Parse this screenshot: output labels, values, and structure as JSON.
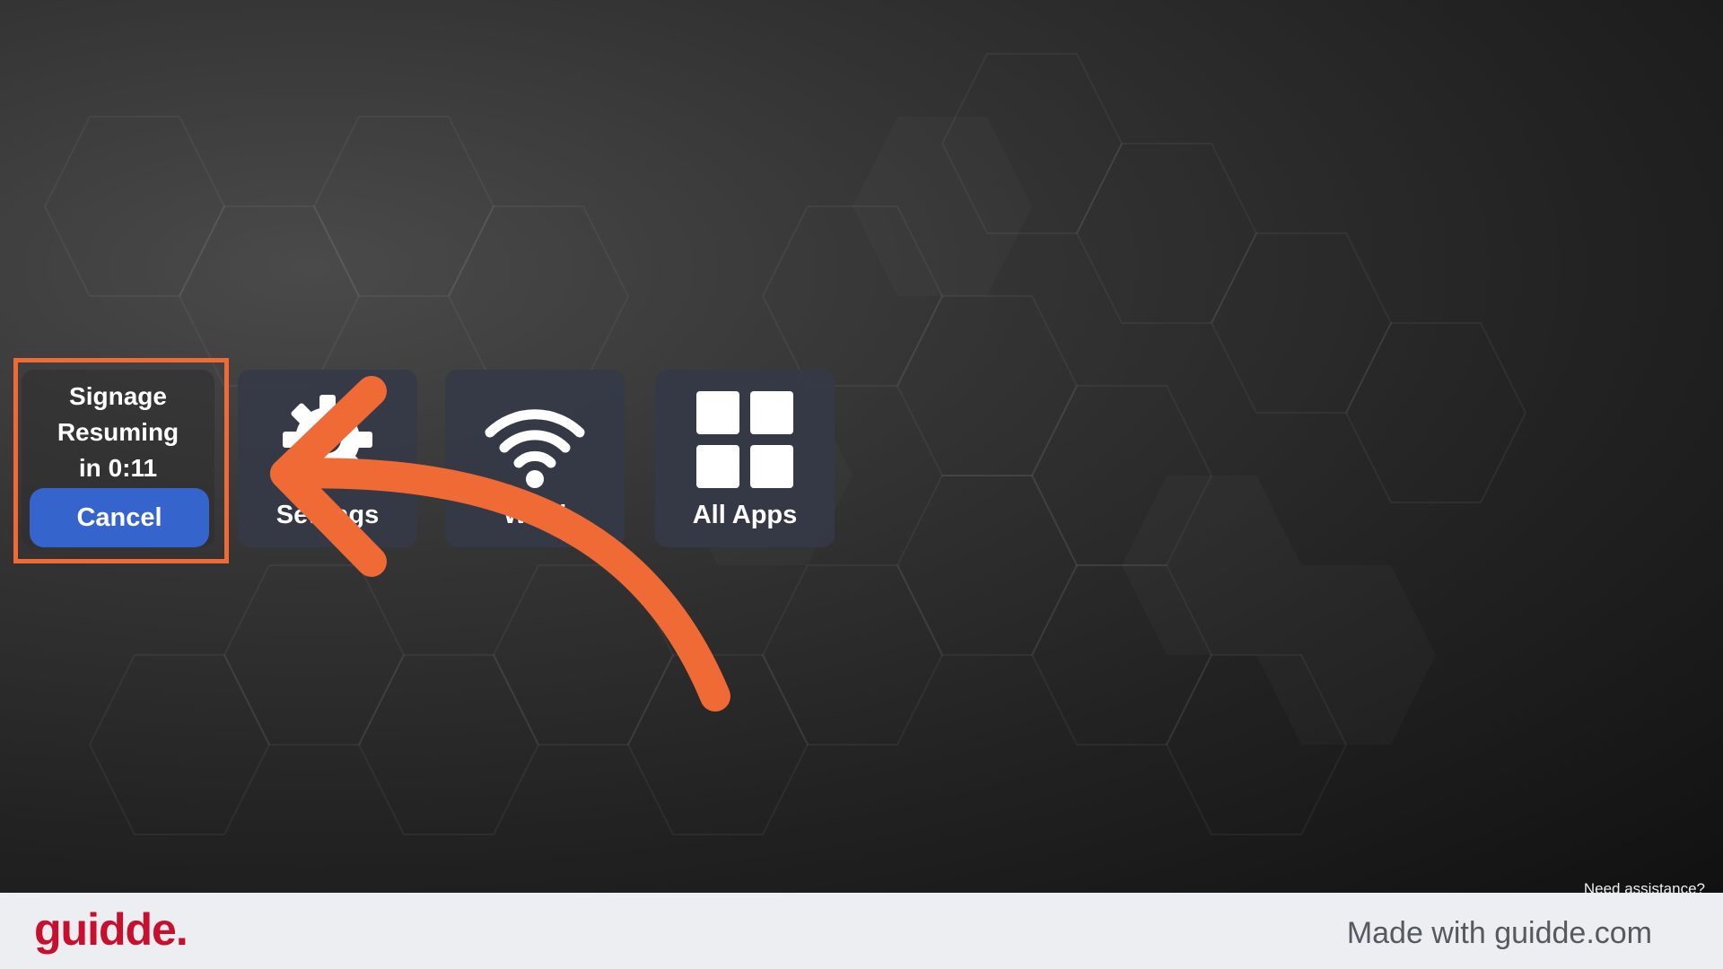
{
  "signage": {
    "line1": "Signage",
    "line2": "Resuming",
    "line3": "in 0:11",
    "cancel_label": "Cancel"
  },
  "tiles": [
    {
      "label": "Settings",
      "icon": "gear-icon"
    },
    {
      "label": "Wi-Fi",
      "icon": "wifi-icon"
    },
    {
      "label": "All Apps",
      "icon": "grid-icon"
    }
  ],
  "help_link": "Need assistance?",
  "footer": {
    "brand": "guidde.",
    "made_with": "Made with guidde.com"
  },
  "colors": {
    "highlight": "#ef6a35",
    "cancel_button": "#3565cc",
    "brand": "#c8102e"
  }
}
